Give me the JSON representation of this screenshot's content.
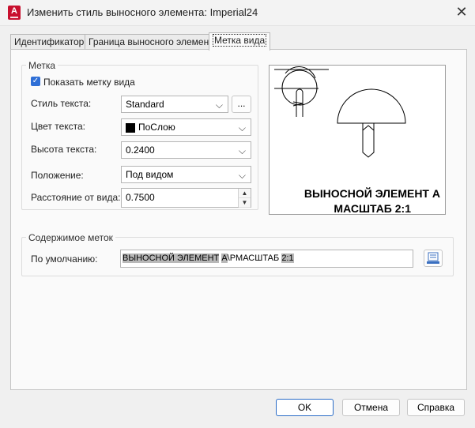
{
  "window": {
    "title": "Изменить стиль выносного элемента: Imperial24"
  },
  "tabs": [
    {
      "label": "Идентификатор"
    },
    {
      "label": "Граница выносного элемента"
    },
    {
      "label": "Метка вида"
    }
  ],
  "mark_group": {
    "title": "Метка",
    "show_label": "Показать метку вида",
    "text_style_label": "Стиль текста:",
    "text_style_value": "Standard",
    "browse_label": "...",
    "text_color_label": "Цвет текста:",
    "text_color_value": "ПоСлою",
    "text_height_label": "Высота текста:",
    "text_height_value": "0.2400",
    "position_label": "Положение:",
    "position_value": "Под видом",
    "offset_label": "Расстояние от вида:",
    "offset_value": "0.7500"
  },
  "preview": {
    "line1": "ВЫНОСНОЙ ЭЛЕМЕНТ А",
    "line2": "МАСШТАБ 2:1"
  },
  "content_group": {
    "title": "Содержимое меток",
    "default_label": "По умолчанию:",
    "field1": "ВЫНОСНОЙ ЭЛЕМЕНТ",
    "field2": "А",
    "field3": "\\PМАСШТАБ",
    "field4": "2:1"
  },
  "footer": {
    "ok": "OK",
    "cancel": "Отмена",
    "help": "Справка"
  }
}
